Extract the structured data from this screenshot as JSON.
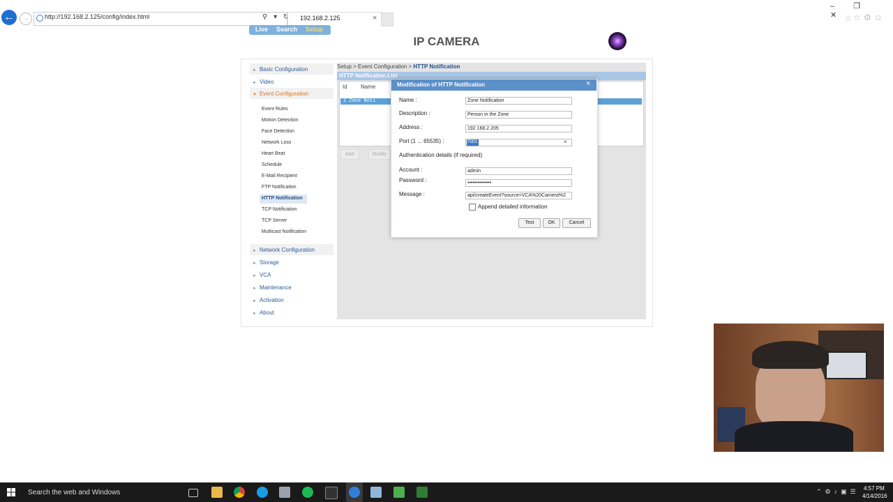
{
  "browser": {
    "url": "http://192.168.2.125/config/index.html",
    "tab_title": "192.168.2.125",
    "tab_close": "×"
  },
  "camera_menu": {
    "live": "Live",
    "search": "Search",
    "setup": "Setup"
  },
  "page_title": "IP CAMERA",
  "sidebar": {
    "top_items": [
      "Basic Configuration",
      "Video",
      "Event Configuration"
    ],
    "sub_items": [
      "Event Rules",
      "Motion Detection",
      "Face Detection",
      "Network Loss",
      "Heart Beat",
      "Schedule",
      "E-Mail Recipient",
      "FTP Notification",
      "HTTP Notification",
      "TCP Notification",
      "TCP Server",
      "Multicast Notification"
    ],
    "bottom_items": [
      "Network Configuration",
      "Storage",
      "VCA",
      "Maintenance",
      "Activation",
      "About"
    ]
  },
  "content": {
    "breadcrumb_prefix": "Setup > Event Configuration > ",
    "breadcrumb_current": "HTTP Notification",
    "list_title": "HTTP Notification List",
    "col_id": "Id",
    "col_name": "Name",
    "row_text": "1    Zone Noti",
    "add": "Add",
    "modify": "Modify"
  },
  "dialog": {
    "title": "Modification of HTTP Notification",
    "close": "×",
    "name_label": "Name :",
    "name_value": "Zone Notification",
    "description_label": "Description :",
    "description_value": "Person in the Zone",
    "address_label": "Address :",
    "address_value": "192.168.2.205",
    "port_label": "Port (1 ... 65535) :",
    "port_value": "7001",
    "port_clear": "×",
    "auth_title": "Authentication details (if required)",
    "account_label": "Account :",
    "account_value": "admin",
    "password_label": "Password :",
    "password_value": "••••••••••••••",
    "message_label": "Message :",
    "message_value": "api/createEvent?source=VCA%20Camera%2",
    "append_label": "Append detailed information",
    "test": "Test",
    "ok": "OK",
    "cancel": "Cancel"
  },
  "taskbar": {
    "search_text": "Search the web and Windows",
    "time": "4:57 PM",
    "date": "4/14/2016"
  }
}
